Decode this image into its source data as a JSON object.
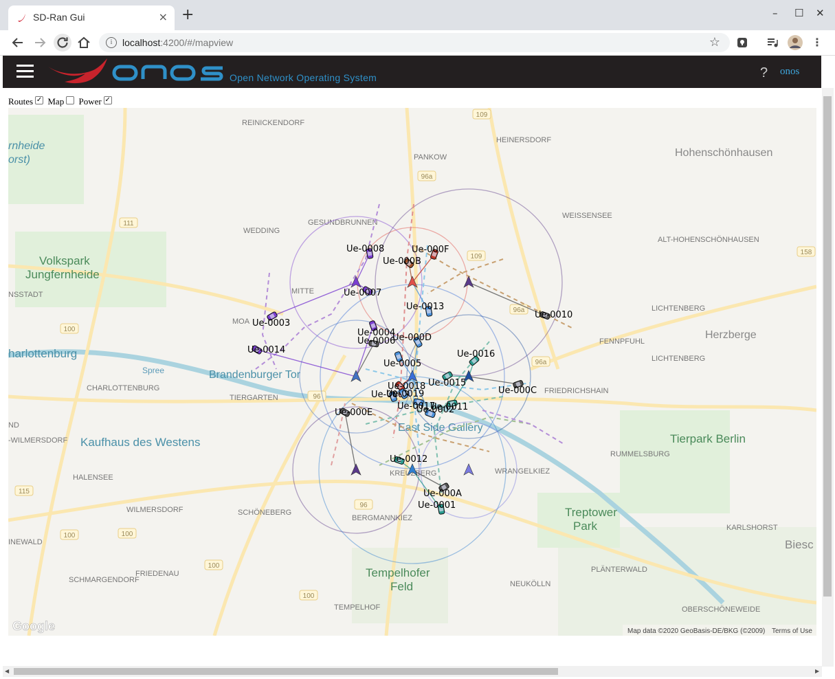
{
  "browser": {
    "tab_title": "SD-Ran Gui",
    "tab_close": "×",
    "new_tab": "+",
    "url_host": "localhost",
    "url_path": ":4200/#/mapview",
    "win_min": "–",
    "win_max": "☐",
    "win_close": "✕"
  },
  "header": {
    "subtitle": "Open Network Operating System",
    "help": "?",
    "user": "onos"
  },
  "controls": {
    "routes_label": "Routes",
    "routes_checked": true,
    "map_label": "Map",
    "map_checked": false,
    "power_label": "Power",
    "power_checked": true
  },
  "map": {
    "place_labels": [
      "REINICKENDORF",
      "PANKOW",
      "HEINERSDORF",
      "Hohenschönhausen",
      "rnheide",
      "orst)",
      "WEDDING",
      "GESUNDBRUNNEN",
      "WEISSENSEE",
      "ALT-HOHENSCHÖNHAUSEN",
      "Volkspark",
      "Jungfernheide",
      "NSSTADT",
      "MITTE",
      "LICHTENBERG",
      "Herzberge",
      "FENNPFUHL",
      "harlottenburg",
      "CHARLOTTENBURG",
      "Brandenburger Tor",
      "TIERGARTEN",
      "LICHTENBERG",
      "FRIEDRICHSHAIN",
      "ND",
      "-WILMERSDORF",
      "Kaufhaus des Westens",
      "East Side Gallery",
      "Tierpark Berlin",
      "RUMMELSBURG",
      "HALENSEE",
      "WILMERSDORF",
      "SCHÖNEBERG",
      "KREUZBERG",
      "WRANGELKIEZ",
      "BERGMANNKIEZ",
      "Treptower",
      "Park",
      "KARLSHORST",
      "INEWALD",
      "Biesc",
      "SCHMARGENDORF",
      "FRIEDENAU",
      "Tempelhofer",
      "Feld",
      "NEUKÖLLN",
      "PLÄNTERWALD",
      "TEMPELHOF",
      "OBERSCHÖNEWEIDE",
      "Spree",
      "MOA"
    ],
    "road_shields": [
      "109",
      "111",
      "96a",
      "109",
      "100",
      "158",
      "96a",
      "96a",
      "96",
      "100",
      "96",
      "115",
      "100",
      "100",
      "100"
    ],
    "google_logo": "Google",
    "map_data": "Map data ©2020 GeoBasis-DE/BKG (©2009)",
    "terms": "Terms of Use"
  },
  "towers": [
    {
      "color": "#7b3fd1"
    },
    {
      "color": "#e0504a"
    },
    {
      "color": "#5a3a8a"
    },
    {
      "color": "#4472c4"
    },
    {
      "color": "#3a6fd8"
    },
    {
      "color": "#1f4fa0"
    },
    {
      "color": "#5a3a8a"
    },
    {
      "color": "#2f7fd0"
    },
    {
      "color": "#7b7be0"
    }
  ],
  "ues": [
    {
      "label": "Ue-0008",
      "color": "#7b3fd1"
    },
    {
      "label": "Ue-000F",
      "color": "#c0392b"
    },
    {
      "label": "Ue-000B",
      "color": "#a0522d"
    },
    {
      "label": "Ue-0007",
      "color": "#7b3fd1"
    },
    {
      "label": "Ue-0003",
      "color": "#7b3fd1"
    },
    {
      "label": "Ue-0013",
      "color": "#4a90d9"
    },
    {
      "label": "Ue-0010",
      "color": "#555"
    },
    {
      "label": "Ue-0004",
      "color": "#7b3fd1"
    },
    {
      "label": "Ue-0006",
      "color": "#555"
    },
    {
      "label": "Ue-000D",
      "color": "#4a90d9"
    },
    {
      "label": "Ue-0014",
      "color": "#7b3fd1"
    },
    {
      "label": "Ue-0016",
      "color": "#2a9d8f"
    },
    {
      "label": "Ue-0005",
      "color": "#4a90d9"
    },
    {
      "label": "Ue-0015",
      "color": "#2a9d8f"
    },
    {
      "label": "Ue-0018",
      "color": "#c0392b"
    },
    {
      "label": "Ue-000C",
      "color": "#555"
    },
    {
      "label": "Ue-0009",
      "color": "#4a90d9"
    },
    {
      "label": "Ue-0019",
      "color": "#4a90d9"
    },
    {
      "label": "Ue-0017",
      "color": "#4a90d9"
    },
    {
      "label": "Ue-0002",
      "color": "#4a90d9"
    },
    {
      "label": "Ue-0011",
      "color": "#2a9d8f"
    },
    {
      "label": "Ue-000E",
      "color": "#555"
    },
    {
      "label": "Ue-0012",
      "color": "#2a9d8f"
    },
    {
      "label": "Ue-000A",
      "color": "#555"
    },
    {
      "label": "Ue-0001",
      "color": "#2a9d8f"
    }
  ]
}
